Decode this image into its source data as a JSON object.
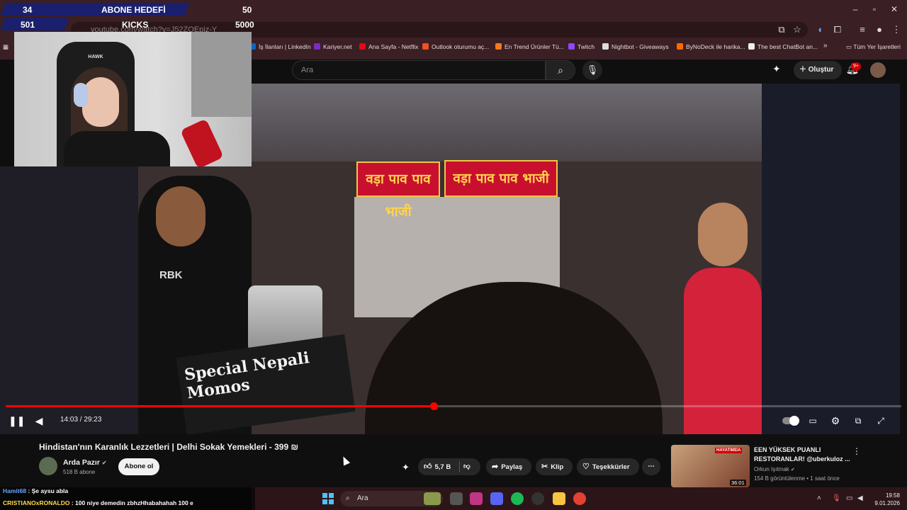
{
  "stream_goal": {
    "row1": {
      "current": "34",
      "label": "ABONE HEDEFİ",
      "target": "50"
    },
    "row2": {
      "current": "501",
      "label": "KICKS",
      "target": "5000"
    }
  },
  "browser": {
    "url": "youtube.com/watch?v=J52ZOEpiz-Y",
    "bookmarks": [
      {
        "label": "İş İlanları | LinkedIn",
        "color": "#0a66c2"
      },
      {
        "label": "Kariyer.net",
        "color": "#7b2cbf"
      },
      {
        "label": "Ana Sayfa - Netflix",
        "color": "#e50914"
      },
      {
        "label": "Outlook oturumu aç...",
        "color": "#f25022"
      },
      {
        "label": "En Trend Ürünler Tü...",
        "color": "#f27a1a"
      },
      {
        "label": "Twitch",
        "color": "#9146ff"
      },
      {
        "label": "Nightbot - Giveaways",
        "color": "#dddddd"
      },
      {
        "label": "ByNoDeck ile harika...",
        "color": "#ff6a00"
      },
      {
        "label": "The best ChatBot an...",
        "color": "#eeeeee"
      }
    ],
    "bookmarks_more": "»",
    "all_bookmarks": "Tüm Yer İşaretleri"
  },
  "youtube": {
    "search_placeholder": "Ara",
    "create_label": "Oluştur",
    "notification_count": "9+"
  },
  "player": {
    "time": "14:03 / 29:23",
    "progress": 0.478,
    "video_text": {
      "sign_left": "वड़ा पाव पाव भाजी",
      "sign_right": "वड़ा पाव पाव भाजी",
      "momos": "Special Nepali Momos",
      "shirt": "RBK"
    }
  },
  "video": {
    "title": "Hindistan'nın Karanlık Lezzetleri | Delhi Sokak Yemekleri - 399 ₪",
    "channel": "Arda Pazır",
    "subscribers": "518 B abone",
    "subscribe_label": "Abone ol",
    "likes": "5,7 B",
    "share_label": "Paylaş",
    "clip_label": "Klip",
    "thanks_label": "Teşekkürler"
  },
  "recommendation": {
    "title": "EEN YÜKSEK PUANLI RESTORANLAR! @uberkuloz ...",
    "channel": "Orkun Işıtmak",
    "meta": "154 B görüntülenme • 1 saat önce",
    "duration": "36:01",
    "thumb_text": "HAYATIMDA"
  },
  "chat": [
    {
      "user": "Hamit68",
      "user_color": "#6aa8ff",
      "message": "Şe aysu abla"
    },
    {
      "user": "CRISTIANOxRONALDO",
      "user_color": "#ffd84a",
      "message": "100 niye demedin zbhzHhabahahah 100 e"
    }
  ],
  "taskbar": {
    "search_placeholder": "Ara",
    "time": "19:58",
    "date": "9.01.2026"
  }
}
